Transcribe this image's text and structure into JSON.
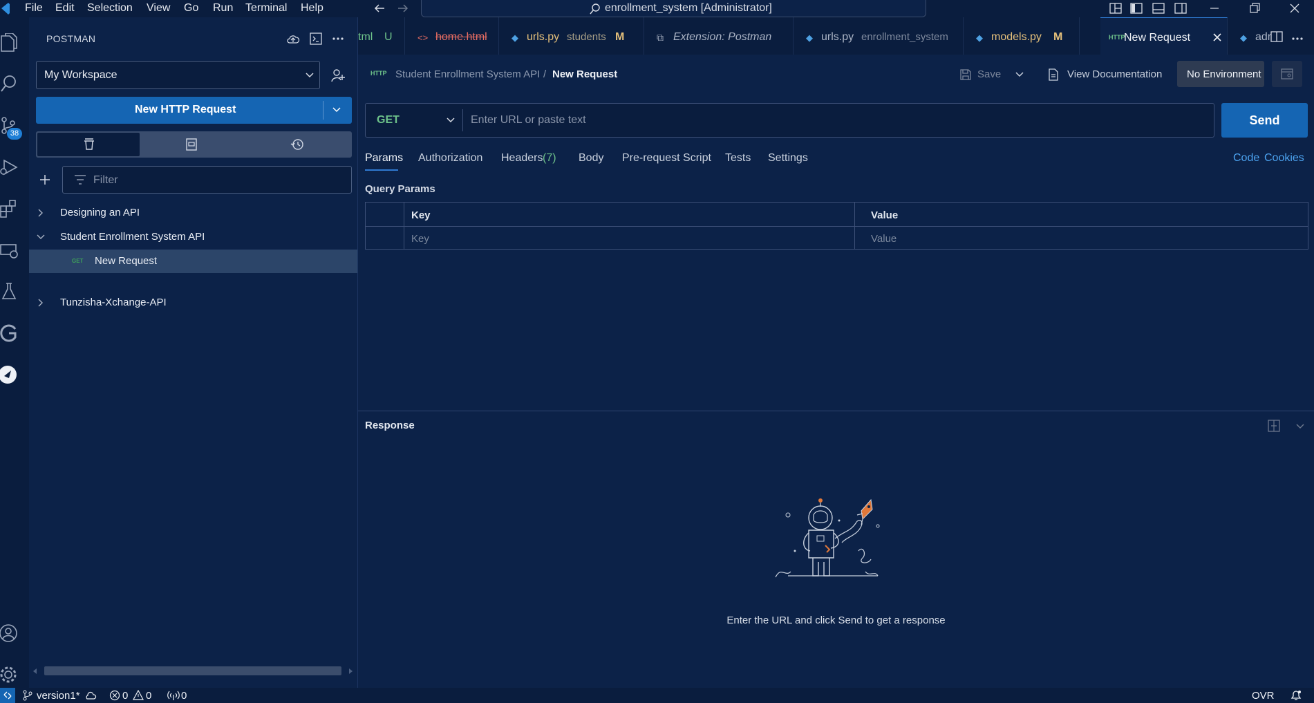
{
  "titlebar": {
    "menu": [
      "File",
      "Edit",
      "Selection",
      "View",
      "Go",
      "Run",
      "Terminal",
      "Help"
    ],
    "command_center": "enrollment_system [Administrator]"
  },
  "activity": {
    "scm_badge": "38"
  },
  "sidebar": {
    "title": "POSTMAN",
    "workspace": "My Workspace",
    "new_request_label": "New HTTP Request",
    "filter_placeholder": "Filter",
    "tree": [
      {
        "label": "Designing an API",
        "expanded": false
      },
      {
        "label": "Student Enrollment System API",
        "expanded": true
      },
      {
        "label": "New Request",
        "method": "GET"
      },
      {
        "label": "Tunzisha-Xchange-API",
        "expanded": false
      }
    ]
  },
  "tabs": [
    {
      "name": "tml",
      "suffix": "U"
    },
    {
      "name": "home.html"
    },
    {
      "name": "urls.py",
      "detail": "students",
      "suffix": "M"
    },
    {
      "name": "Extension: Postman"
    },
    {
      "name": "urls.py",
      "detail": "enrollment_system"
    },
    {
      "name": "models.py",
      "suffix": "M"
    },
    {
      "name": "New Request"
    },
    {
      "name": "adr"
    }
  ],
  "request": {
    "breadcrumb_collection": "Student Enrollment System API",
    "breadcrumb_sep": "/",
    "breadcrumb_name": "New Request",
    "save_label": "Save",
    "view_doc_label": "View Documentation",
    "environment": "No Environment",
    "method": "GET",
    "url_placeholder": "Enter URL or paste text",
    "send_label": "Send",
    "tabs": [
      "Params",
      "Authorization",
      "Headers",
      "Body",
      "Pre-request Script",
      "Tests",
      "Settings"
    ],
    "headers_count": "(7)",
    "code_link": "Code",
    "cookies_link": "Cookies",
    "query_params_title": "Query Params",
    "col_key": "Key",
    "col_value": "Value",
    "key_placeholder": "Key",
    "value_placeholder": "Value"
  },
  "response": {
    "title": "Response",
    "empty_message": "Enter the URL and click Send to get a response"
  },
  "statusbar": {
    "branch": "version1*",
    "errors": "0",
    "warnings": "0",
    "ports": "0",
    "mode": "OVR"
  },
  "colors": {
    "accent": "#1565b3",
    "background": "#0c2248"
  }
}
